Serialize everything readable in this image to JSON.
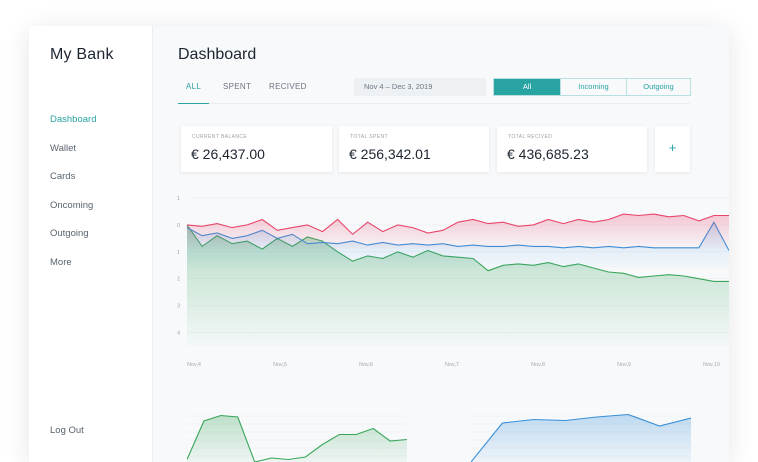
{
  "brand": "My Bank",
  "sidebar": {
    "items": [
      {
        "label": "Dashboard",
        "active": true
      },
      {
        "label": "Wallet",
        "active": false
      },
      {
        "label": "Cards",
        "active": false
      },
      {
        "label": "Oncoming",
        "active": false
      },
      {
        "label": "Outgoing",
        "active": false
      },
      {
        "label": "More",
        "active": false
      }
    ],
    "logout": "Log Out"
  },
  "header": {
    "title": "Dashboard",
    "tabs": [
      "ALL",
      "SPENT",
      "RECIVED"
    ],
    "active_tab": "ALL",
    "date_range": "Nov 4 – Dec 3, 2019",
    "filters": [
      "All",
      "Incoming",
      "Outgoing"
    ],
    "active_filter": "All"
  },
  "cards": [
    {
      "label": "CURRENT BALANCE",
      "value": "€ 26,437.00"
    },
    {
      "label": "TOTAL SPENT",
      "value": "€ 256,342.01"
    },
    {
      "label": "TOTAL RECIVED",
      "value": "€ 436,685.23"
    }
  ],
  "add_card_label": "+",
  "colors": {
    "accent": "#2aa3a3",
    "red": "#e8456a",
    "blue": "#3a8fd8",
    "green": "#3aa55a"
  },
  "chart_data": [
    {
      "type": "line",
      "y_tick_labels": [
        "1",
        "0",
        "1",
        "2",
        "3",
        "4"
      ],
      "x_tick_labels": [
        "Nov,4",
        "Nov,5",
        "Nov,6",
        "Nov,7",
        "Nov,8",
        "Nov,9",
        "Nov,10"
      ],
      "ylim": [
        -4.5,
        1
      ],
      "grid": true,
      "series": [
        {
          "color": "red",
          "values": [
            0.0,
            -0.05,
            0.05,
            -0.1,
            0.0,
            0.2,
            -0.2,
            -0.1,
            0.0,
            -0.25,
            0.2,
            -0.35,
            0.1,
            -0.25,
            0.0,
            -0.1,
            -0.3,
            -0.2,
            0.1,
            0.2,
            0.05,
            0.1,
            -0.05,
            0.0,
            0.2,
            0.05,
            0.2,
            0.1,
            0.2,
            0.4,
            0.35,
            0.4,
            0.3,
            0.35,
            0.15,
            0.35,
            0.35
          ]
        },
        {
          "color": "blue",
          "values": [
            -0.1,
            -0.4,
            -0.3,
            -0.5,
            -0.4,
            -0.2,
            -0.5,
            -0.35,
            -0.7,
            -0.65,
            -0.7,
            -0.6,
            -0.75,
            -0.65,
            -0.75,
            -0.7,
            -0.75,
            -0.7,
            -0.8,
            -0.75,
            -0.8,
            -0.8,
            -0.75,
            -0.8,
            -0.8,
            -0.85,
            -0.8,
            -0.85,
            -0.8,
            -0.85,
            -0.8,
            -0.85,
            -0.85,
            -0.85,
            -0.85,
            0.1,
            -0.95
          ]
        },
        {
          "color": "green",
          "values": [
            0.0,
            -0.8,
            -0.4,
            -0.7,
            -0.6,
            -0.9,
            -0.5,
            -0.8,
            -0.45,
            -0.6,
            -1.0,
            -1.35,
            -1.15,
            -1.25,
            -1.0,
            -1.2,
            -0.95,
            -1.15,
            -1.2,
            -1.25,
            -1.7,
            -1.5,
            -1.45,
            -1.5,
            -1.4,
            -1.55,
            -1.45,
            -1.6,
            -1.75,
            -1.8,
            -1.95,
            -1.9,
            -1.85,
            -1.9,
            -2.0,
            -2.1,
            -2.1
          ]
        }
      ]
    },
    {
      "type": "area",
      "series": [
        {
          "color": "green",
          "values": [
            0.05,
            0.82,
            0.93,
            0.9,
            0.0,
            0.08,
            0.05,
            0.1,
            0.35,
            0.55,
            0.55,
            0.67,
            0.42,
            0.45
          ]
        }
      ]
    },
    {
      "type": "area",
      "series": [
        {
          "color": "blue",
          "values": [
            0.0,
            0.78,
            0.85,
            0.83,
            0.9,
            0.95,
            0.72,
            0.88
          ]
        }
      ]
    }
  ]
}
